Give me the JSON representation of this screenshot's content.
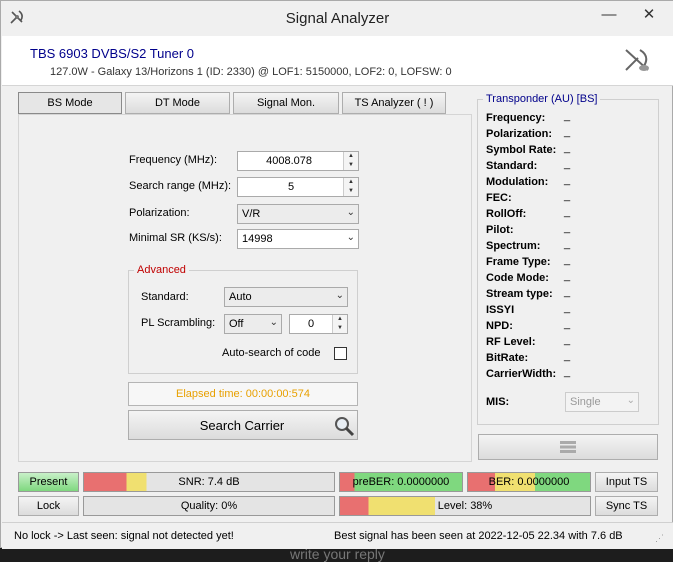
{
  "window": {
    "title": "Signal Analyzer",
    "minimize": "—",
    "close": "✕"
  },
  "header": {
    "tuner": "TBS 6903 DVBS/S2 Tuner 0",
    "satellite": "127.0W - Galaxy 13/Horizons 1 (ID: 2330) @ LOF1: 5150000, LOF2: 0, LOFSW: 0"
  },
  "tabs": [
    {
      "label": "BS Mode",
      "active": true
    },
    {
      "label": "DT Mode",
      "active": false
    },
    {
      "label": "Signal Mon.",
      "active": false
    },
    {
      "label": "TS Analyzer ( ! )",
      "active": false
    }
  ],
  "form": {
    "frequency_label": "Frequency (MHz):",
    "frequency_value": "4008.078",
    "search_range_label": "Search range (MHz):",
    "search_range_value": "5",
    "polarization_label": "Polarization:",
    "polarization_value": "V/R",
    "minimal_sr_label": "Minimal SR (KS/s):",
    "minimal_sr_value": "14998"
  },
  "advanced": {
    "title": "Advanced",
    "standard_label": "Standard:",
    "standard_value": "Auto",
    "pl_scrambling_label": "PL Scrambling:",
    "pl_scrambling_value": "Off",
    "pl_scrambling_number": "0",
    "auto_search_label": "Auto-search of code"
  },
  "elapsed": "Elapsed time: 00:00:00:574",
  "search_button": "Search Carrier",
  "transponder": {
    "title": "Transponder (AU) [BS]",
    "fields": [
      {
        "label": "Frequency:",
        "value": "_"
      },
      {
        "label": "Polarization:",
        "value": "_"
      },
      {
        "label": "Symbol Rate:",
        "value": "_"
      },
      {
        "label": "Standard:",
        "value": "_"
      },
      {
        "label": "Modulation:",
        "value": "_"
      },
      {
        "label": "FEC:",
        "value": "_"
      },
      {
        "label": "RollOff:",
        "value": "_"
      },
      {
        "label": "Pilot:",
        "value": "_"
      },
      {
        "label": "Spectrum:",
        "value": "_"
      },
      {
        "label": "Frame Type:",
        "value": "_"
      },
      {
        "label": "Code Mode:",
        "value": "_"
      },
      {
        "label": "Stream type:",
        "value": "_"
      },
      {
        "label": "ISSYI",
        "value": "_"
      },
      {
        "label": "NPD:",
        "value": "_"
      },
      {
        "label": "RF Level:",
        "value": "_"
      },
      {
        "label": "BitRate:",
        "value": "_"
      },
      {
        "label": "CarrierWidth:",
        "value": "_"
      }
    ],
    "mis_label": "MIS:",
    "mis_value": "Single"
  },
  "meters": {
    "present": "Present",
    "lock": "Lock",
    "snr": "SNR: 7.4 dB",
    "quality": "Quality: 0%",
    "preber": "preBER: 0.0000000",
    "ber": "BER: 0.0000000",
    "level": "Level: 38%",
    "level_fraction": 0.38,
    "input_ts": "Input TS",
    "sync_ts": "Sync TS"
  },
  "status": {
    "left": "No lock -> Last seen: signal not detected yet!",
    "right": "Best signal has been seen at 2022-12-05 22.34 with 7.6 dB"
  },
  "background": {
    "reply_text": "write your reply"
  }
}
